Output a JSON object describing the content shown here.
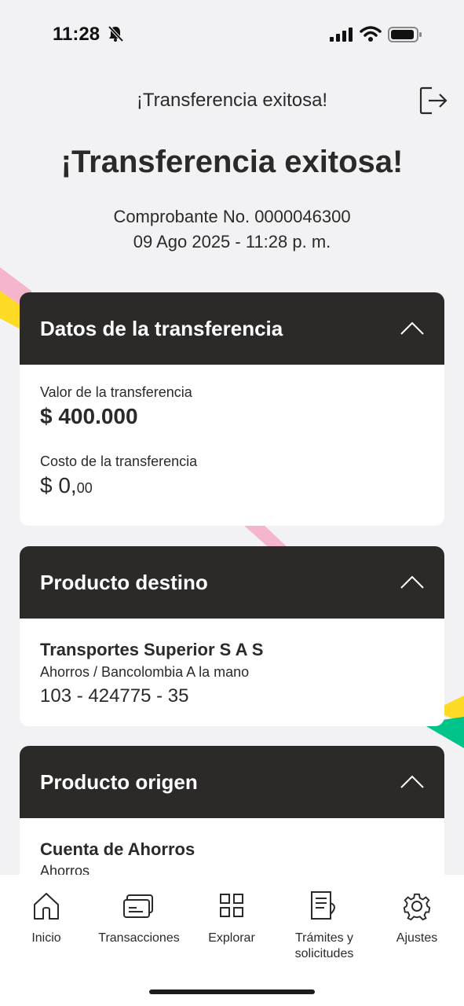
{
  "status_bar": {
    "time": "11:28"
  },
  "header": {
    "title": "¡Transferencia exitosa!"
  },
  "hero": {
    "title": "¡Transferencia exitosa!",
    "receipt": "Comprobante No. 0000046300",
    "datetime": "09 Ago 2025 - 11:28 p. m."
  },
  "transfer_card": {
    "title": "Datos de la transferencia",
    "value_label": "Valor de la transferencia",
    "value": "$ 400.000",
    "cost_label": "Costo de la transferencia",
    "cost_main": "$ 0,",
    "cost_cents": "00"
  },
  "destination_card": {
    "title": "Producto destino",
    "name": "Transportes Superior S A S",
    "type": "Ahorros / Bancolombia A la mano",
    "account": "103 - 424775 - 35"
  },
  "origin_card": {
    "title": "Producto origen",
    "name": "Cuenta de Ahorros",
    "type": "Ahorros"
  },
  "nav": {
    "items": [
      {
        "label": "Inicio",
        "icon": "home-icon"
      },
      {
        "label": "Transacciones",
        "icon": "card-icon"
      },
      {
        "label": "Explorar",
        "icon": "grid-icon"
      },
      {
        "label": "Trámites y solicitudes",
        "icon": "document-icon"
      },
      {
        "label": "Ajustes",
        "icon": "gear-icon"
      }
    ]
  },
  "colors": {
    "header_bg": "#2c2a29",
    "background": "#f2f2f4",
    "accent_yellow": "#fdda24",
    "accent_pink": "#f5b6cd",
    "accent_green": "#00c389"
  }
}
